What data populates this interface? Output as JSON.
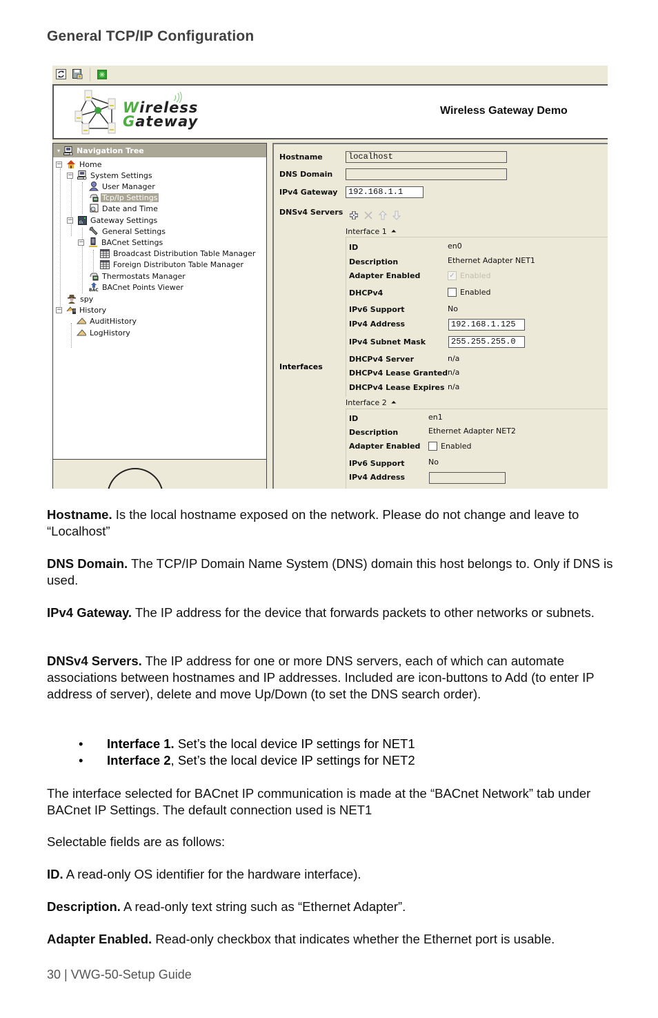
{
  "heading": "General TCP/IP Configuration",
  "app": {
    "toolbar": {
      "buttons": [
        {
          "name": "refresh-icon"
        },
        {
          "name": "save-icon"
        },
        {
          "name": "connect-icon"
        }
      ]
    },
    "logo": {
      "line1_initial": "W",
      "line1_rest": "ireless",
      "line2_initial": "G",
      "line2_rest": "ateway"
    },
    "title": "Wireless Gateway Demo",
    "nav": {
      "header": "Navigation Tree",
      "items": [
        {
          "label": "Home",
          "icon": "home-icon",
          "level": 0,
          "expanded": true
        },
        {
          "label": "System Settings",
          "icon": "computer-icon",
          "level": 1,
          "expanded": true
        },
        {
          "label": "User Manager",
          "icon": "user-icon",
          "level": 2
        },
        {
          "label": "Tcp/Ip Settings",
          "icon": "network-icon",
          "level": 2,
          "selected": true
        },
        {
          "label": "Date and Time",
          "icon": "clock-icon",
          "level": 2
        },
        {
          "label": "Gateway Settings",
          "icon": "gateway-icon",
          "level": 1,
          "expanded": true
        },
        {
          "label": "General Settings",
          "icon": "wrench-icon",
          "level": 2
        },
        {
          "label": "BACnet Settings",
          "icon": "server-icon",
          "level": 2,
          "expanded": true
        },
        {
          "label": "Broadcast Distribution Table Manager",
          "icon": "table-icon",
          "level": 3
        },
        {
          "label": "Foreign Distributon Table Manager",
          "icon": "table-icon",
          "level": 3
        },
        {
          "label": "Thermostats Manager",
          "icon": "network-icon",
          "level": 2
        },
        {
          "label": "BACnet Points Viewer",
          "icon": "bacnet-icon",
          "level": 2
        },
        {
          "label": "spy",
          "icon": "spy-icon",
          "level": 0
        },
        {
          "label": "History",
          "icon": "history-icon",
          "level": 0,
          "expanded": true
        },
        {
          "label": "AuditHistory",
          "icon": "triangle-icon",
          "level": 1
        },
        {
          "label": "LogHistory",
          "icon": "triangle-icon",
          "level": 1
        }
      ]
    },
    "form": {
      "hostname_label": "Hostname",
      "hostname_value": "localhost",
      "dns_domain_label": "DNS Domain",
      "dns_domain_value": "",
      "gateway_label": "IPv4 Gateway",
      "gateway_value": "192.168.1.1",
      "dns_servers_label": "DNSv4 Servers",
      "interfaces_label": "Interfaces",
      "interface1": {
        "header": "Interface 1",
        "id_label": "ID",
        "id_value": "en0",
        "desc_label": "Description",
        "desc_value": "Ethernet Adapter NET1",
        "adapter_label": "Adapter Enabled",
        "adapter_checkbox_label": "Enabled",
        "adapter_checked": true,
        "dhcp_label": "DHCPv4",
        "dhcp_checkbox_label": "Enabled",
        "dhcp_checked": false,
        "ipv6_label": "IPv6 Support",
        "ipv6_value": "No",
        "ipv4_label": "IPv4 Address",
        "ipv4_value": "192.168.1.125",
        "mask_label": "IPv4 Subnet Mask",
        "mask_value": "255.255.255.0",
        "dhcp_server_label": "DHCPv4 Server",
        "dhcp_server_value": "n/a",
        "lease_granted_label": "DHCPv4 Lease Granted",
        "lease_granted_value": "n/a",
        "lease_expires_label": "DHCPv4 Lease Expires",
        "lease_expires_value": "n/a"
      },
      "interface2": {
        "header": "Interface 2",
        "id_label": "ID",
        "id_value": "en1",
        "desc_label": "Description",
        "desc_value": "Ethernet Adapter NET2",
        "adapter_label": "Adapter Enabled",
        "adapter_checkbox_label": "Enabled",
        "adapter_checked": false,
        "ipv6_label": "IPv6 Support",
        "ipv6_value": "No",
        "ipv4_label": "IPv4 Address",
        "ipv4_value": ""
      }
    }
  },
  "body": {
    "hostname": {
      "term": "Hostname.",
      "text": " Is the local hostname exposed on the network. Please do not change and leave to “Localhost”"
    },
    "dns_domain": {
      "term": "DNS Domain.",
      "text": " The TCP/IP Domain Name System (DNS) domain this host belongs to. Only if DNS is used."
    },
    "gateway": {
      "term": "IPv4 Gateway.",
      "text": " The IP address for the device that forwards packets to other networks or subnets."
    },
    "dns_servers": {
      "term": "DNSv4 Servers.",
      "text": " The IP address for one or more DNS servers, each of which can automate associations between hostnames and IP addresses. Included are icon-buttons to Add (to enter IP address of server), delete and move Up/Down (to set the DNS search order)."
    },
    "bullets": [
      {
        "term": "Interface 1.",
        "text": " Set’s the local device IP settings for NET1"
      },
      {
        "term": "Interface 2",
        "text": ", Set’s the local device IP settings for NET2"
      }
    ],
    "bacnet_note": "The interface selected for BACnet IP communication is made at the “BACnet Network” tab under BACnet IP Settings. The default connection used is NET1",
    "selectable_intro": "Selectable fields are as follows:",
    "id_field": {
      "term": "ID.",
      "text": " A read-only OS identifier for the hardware interface)."
    },
    "description_field": {
      "term": "Description.",
      "text": " A read-only text string such as “Ethernet Adapter”."
    },
    "adapter_field": {
      "term": "Adapter Enabled.",
      "text": " Read-only checkbox that indicates whether the Ethernet port is usable."
    }
  },
  "footer": "30 | VWG-50-Setup Guide"
}
